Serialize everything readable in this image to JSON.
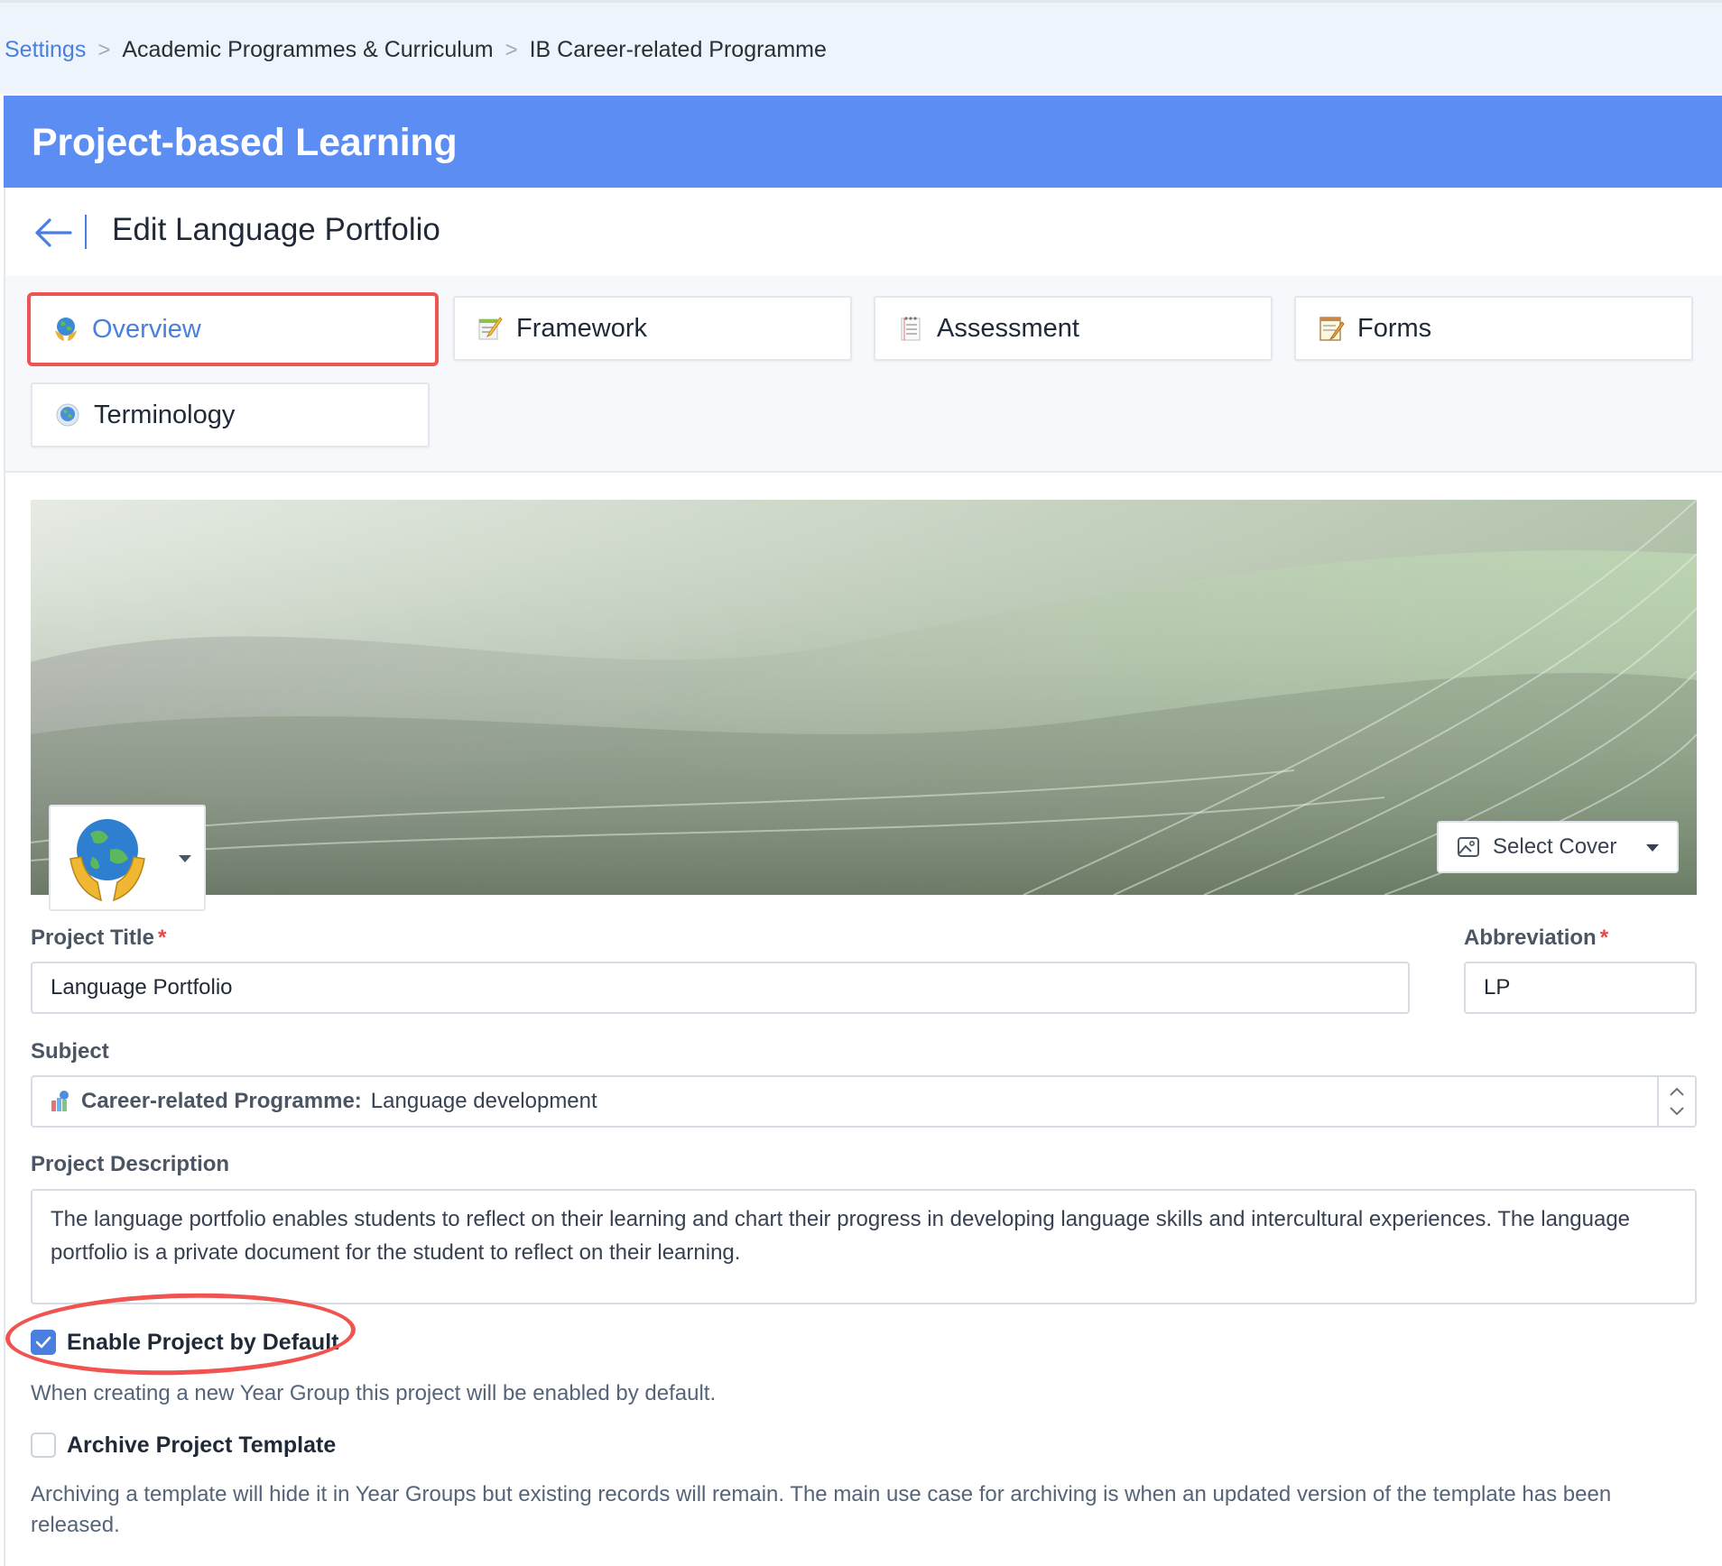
{
  "breadcrumb": {
    "items": [
      "Settings",
      "Academic Programmes & Curriculum",
      "IB Career-related Programme"
    ],
    "separator": ">"
  },
  "header": {
    "title": "Project-based Learning"
  },
  "subheader": {
    "title": "Edit Language Portfolio",
    "back_icon": "arrow-left-icon"
  },
  "tabs": [
    {
      "label": "Overview",
      "icon": "earth-in-hands-icon",
      "active": true
    },
    {
      "label": "Framework",
      "icon": "memo-icon",
      "active": false
    },
    {
      "label": "Assessment",
      "icon": "spiral-notepad-icon",
      "active": false
    },
    {
      "label": "Forms",
      "icon": "notepad-pencil-icon",
      "active": false
    },
    {
      "label": "Terminology",
      "icon": "globe-icon",
      "active": false
    }
  ],
  "cover": {
    "select_label": "Select Cover",
    "select_icon": "image-icon",
    "project_icon": "earth-in-hands-icon"
  },
  "form": {
    "project_title_label": "Project Title",
    "project_title_value": "Language Portfolio",
    "abbreviation_label": "Abbreviation",
    "abbreviation_value": "LP",
    "required_mark": "*",
    "subject_label": "Subject",
    "subject_prefix": "Career-related Programme:",
    "subject_value": "Language development",
    "description_label": "Project Description",
    "description_value": "The language portfolio enables students to reflect on their learning and chart their progress in developing language skills and intercultural experiences. The language portfolio is a private document for the student to reflect on their learning.",
    "enable_default_label": "Enable Project by Default",
    "enable_default_checked": true,
    "enable_default_help": "When creating a new Year Group this project will be enabled by default.",
    "archive_label": "Archive Project Template",
    "archive_checked": false,
    "archive_help": "Archiving a template will hide it in Year Groups but existing records will remain. The main use case for archiving is when an updated version of the template has been released."
  },
  "colors": {
    "accent": "#4a7fe0",
    "header_bg": "#5b8df2",
    "annotation": "#ef5450",
    "required": "#e84545"
  }
}
